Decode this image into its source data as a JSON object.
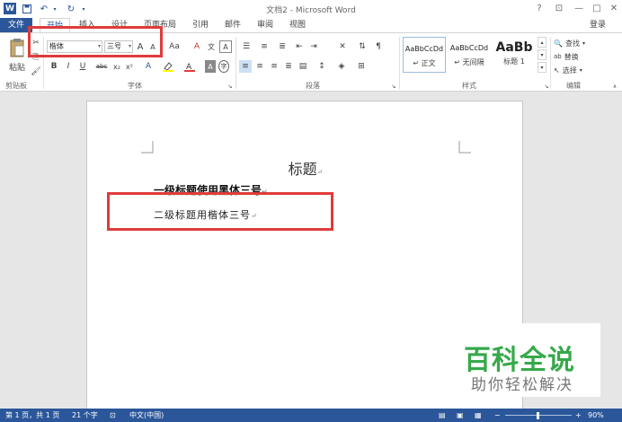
{
  "window": {
    "title": "文档2 - Microsoft Word",
    "help": "?",
    "min": "—",
    "max": "□",
    "close": "✕"
  },
  "quick_access": {
    "save_icon": "save-icon",
    "undo_icon": "undo-icon",
    "redo_icon": "redo-icon"
  },
  "tabs": {
    "file": "文件",
    "items": [
      "开始",
      "插入",
      "设计",
      "页面布局",
      "引用",
      "邮件",
      "审阅",
      "视图"
    ],
    "active_index": 0,
    "login": "登录"
  },
  "ribbon": {
    "clipboard": {
      "paste": "粘贴",
      "label": "剪贴板"
    },
    "font": {
      "name": "楷体",
      "size": "三号",
      "label": "字体",
      "bold": "B",
      "italic": "I",
      "underline": "U",
      "strike": "abc",
      "sub": "x₂",
      "sup": "x²",
      "grow": "A",
      "shrink": "A",
      "case": "Aa",
      "clear": "A"
    },
    "paragraph": {
      "label": "段落"
    },
    "styles": {
      "label": "样式",
      "items": [
        {
          "sample": "AaBbCcDd",
          "name": "↵ 正文"
        },
        {
          "sample": "AaBbCcDd",
          "name": "↵ 无间隔"
        },
        {
          "sample": "AaBb",
          "name": "标题 1"
        }
      ]
    },
    "editing": {
      "label": "编辑",
      "find": "查找",
      "replace": "替换",
      "select": "选择"
    }
  },
  "document": {
    "heading": "标题",
    "line1": "一级标题使用黑体三号",
    "line2": "二级标题用楷体三号",
    "para_mark": "↵"
  },
  "watermark": {
    "title": "百科全说",
    "subtitle": "助你轻松解决"
  },
  "statusbar": {
    "page": "第 1 页，共 1 页",
    "words": "21 个字",
    "lang": "中文(中国)",
    "zoom": "90%"
  },
  "colors": {
    "accent": "#2b579a",
    "highlight_box": "#e03b3b",
    "watermark_green": "#36a94a"
  }
}
